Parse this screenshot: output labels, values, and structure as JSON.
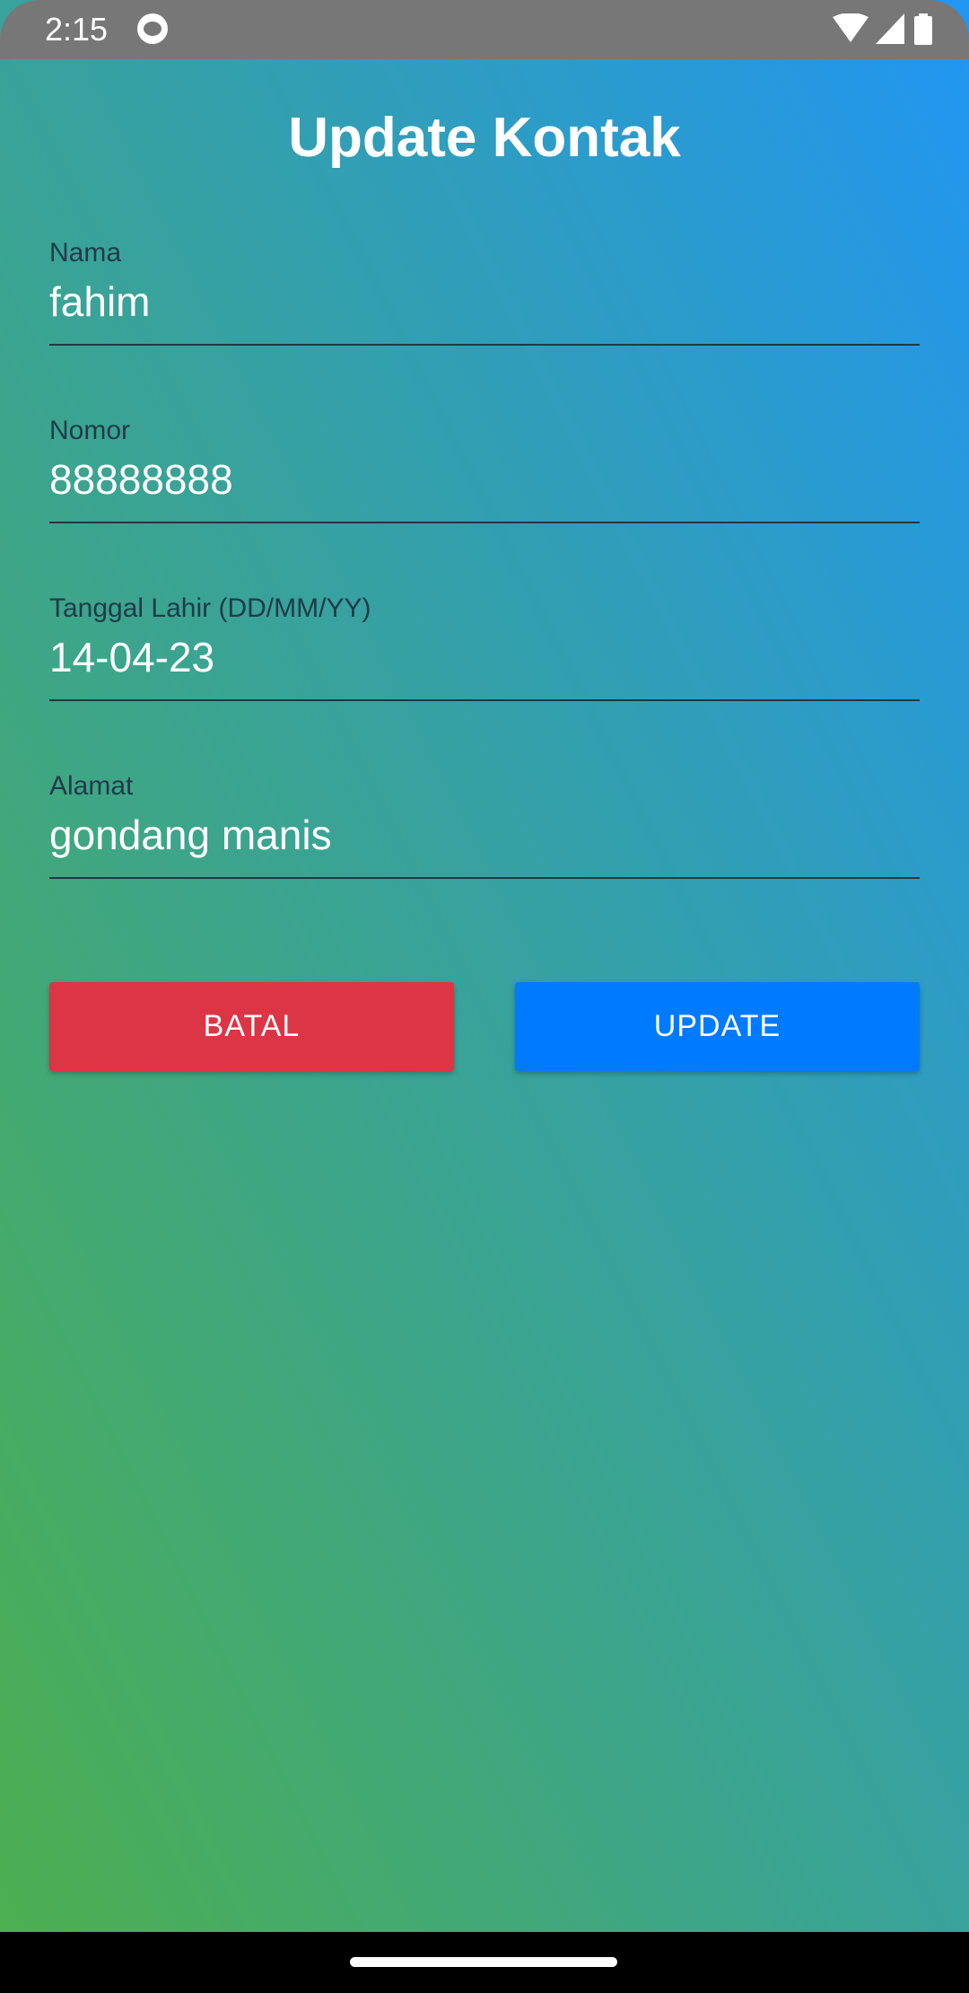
{
  "status_bar": {
    "time": "2:15"
  },
  "header": {
    "title": "Update Kontak"
  },
  "form": {
    "fields": [
      {
        "label": "Nama",
        "value": "fahim"
      },
      {
        "label": "Nomor",
        "value": "88888888"
      },
      {
        "label": "Tanggal Lahir (DD/MM/YY)",
        "value": "14-04-23"
      },
      {
        "label": "Alamat",
        "value": "gondang manis"
      }
    ]
  },
  "buttons": {
    "cancel": "BATAL",
    "update": "UPDATE"
  },
  "colors": {
    "cancel": "#dc3545",
    "update": "#007bff",
    "gradient_top": "#2196f3",
    "gradient_bottom": "#4caf50"
  }
}
